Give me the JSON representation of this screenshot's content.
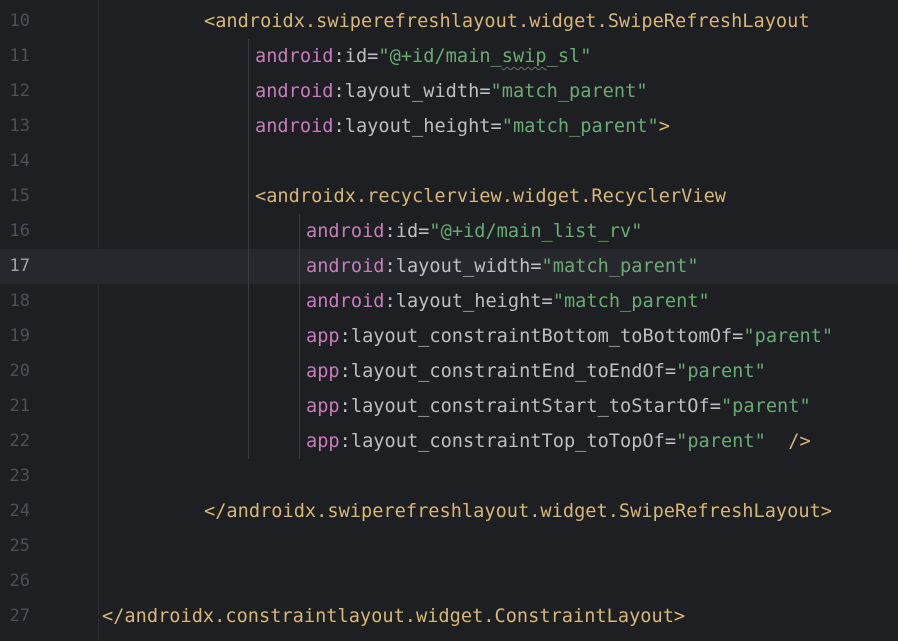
{
  "editor": {
    "current_line": "17",
    "lines": [
      {
        "num": "10",
        "indent": 2,
        "tokens": [
          {
            "t": "tag",
            "v": "<androidx.swiperefreshlayout.widget.SwipeRefreshLayout"
          }
        ]
      },
      {
        "num": "11",
        "indent": 3,
        "tokens": [
          {
            "t": "ns",
            "v": "android"
          },
          {
            "t": "punc",
            "v": ":"
          },
          {
            "t": "attr",
            "v": "id"
          },
          {
            "t": "punc",
            "v": "="
          },
          {
            "t": "str",
            "v": "\"@+id/main_"
          },
          {
            "t": "str",
            "v": "swip",
            "squiggle": true
          },
          {
            "t": "str",
            "v": "_sl\""
          }
        ]
      },
      {
        "num": "12",
        "indent": 3,
        "tokens": [
          {
            "t": "ns",
            "v": "android"
          },
          {
            "t": "punc",
            "v": ":"
          },
          {
            "t": "attr",
            "v": "layout_width"
          },
          {
            "t": "punc",
            "v": "="
          },
          {
            "t": "str",
            "v": "\"match_parent\""
          }
        ]
      },
      {
        "num": "13",
        "indent": 3,
        "tokens": [
          {
            "t": "ns",
            "v": "android"
          },
          {
            "t": "punc",
            "v": ":"
          },
          {
            "t": "attr",
            "v": "layout_height"
          },
          {
            "t": "punc",
            "v": "="
          },
          {
            "t": "str",
            "v": "\"match_parent\""
          },
          {
            "t": "tag",
            "v": ">"
          }
        ]
      },
      {
        "num": "14",
        "indent": 0,
        "tokens": []
      },
      {
        "num": "15",
        "indent": 3,
        "tokens": [
          {
            "t": "tag",
            "v": "<androidx.recyclerview.widget.RecyclerView"
          }
        ]
      },
      {
        "num": "16",
        "indent": 4,
        "tokens": [
          {
            "t": "ns",
            "v": "android"
          },
          {
            "t": "punc",
            "v": ":"
          },
          {
            "t": "attr",
            "v": "id"
          },
          {
            "t": "punc",
            "v": "="
          },
          {
            "t": "str",
            "v": "\"@+id/main_list_rv\""
          }
        ]
      },
      {
        "num": "17",
        "indent": 4,
        "tokens": [
          {
            "t": "ns",
            "v": "android"
          },
          {
            "t": "punc",
            "v": ":"
          },
          {
            "t": "attr",
            "v": "layout_width"
          },
          {
            "t": "punc",
            "v": "="
          },
          {
            "t": "str",
            "v": "\"match_parent\""
          }
        ]
      },
      {
        "num": "18",
        "indent": 4,
        "tokens": [
          {
            "t": "ns",
            "v": "android"
          },
          {
            "t": "punc",
            "v": ":"
          },
          {
            "t": "attr",
            "v": "layout_height"
          },
          {
            "t": "punc",
            "v": "="
          },
          {
            "t": "str",
            "v": "\"match_parent\""
          }
        ]
      },
      {
        "num": "19",
        "indent": 4,
        "tokens": [
          {
            "t": "ns",
            "v": "app"
          },
          {
            "t": "punc",
            "v": ":"
          },
          {
            "t": "attr",
            "v": "layout_constraintBottom_toBottomOf"
          },
          {
            "t": "punc",
            "v": "="
          },
          {
            "t": "str",
            "v": "\"parent\""
          }
        ]
      },
      {
        "num": "20",
        "indent": 4,
        "tokens": [
          {
            "t": "ns",
            "v": "app"
          },
          {
            "t": "punc",
            "v": ":"
          },
          {
            "t": "attr",
            "v": "layout_constraintEnd_toEndOf"
          },
          {
            "t": "punc",
            "v": "="
          },
          {
            "t": "str",
            "v": "\"parent\""
          }
        ]
      },
      {
        "num": "21",
        "indent": 4,
        "tokens": [
          {
            "t": "ns",
            "v": "app"
          },
          {
            "t": "punc",
            "v": ":"
          },
          {
            "t": "attr",
            "v": "layout_constraintStart_toStartOf"
          },
          {
            "t": "punc",
            "v": "="
          },
          {
            "t": "str",
            "v": "\"parent\""
          }
        ]
      },
      {
        "num": "22",
        "indent": 4,
        "tokens": [
          {
            "t": "ns",
            "v": "app"
          },
          {
            "t": "punc",
            "v": ":"
          },
          {
            "t": "attr",
            "v": "layout_constraintTop_toTopOf"
          },
          {
            "t": "punc",
            "v": "="
          },
          {
            "t": "str",
            "v": "\"parent\""
          },
          {
            "t": "tag",
            "v": "  />"
          }
        ]
      },
      {
        "num": "23",
        "indent": 0,
        "tokens": []
      },
      {
        "num": "24",
        "indent": 2,
        "tokens": [
          {
            "t": "tag",
            "v": "</androidx.swiperefreshlayout.widget.SwipeRefreshLayout>"
          }
        ]
      },
      {
        "num": "25",
        "indent": 0,
        "tokens": []
      },
      {
        "num": "26",
        "indent": 0,
        "tokens": []
      },
      {
        "num": "27",
        "indent": 0,
        "tokens": [
          {
            "t": "tag",
            "v": "</androidx.constraintlayout.widget.ConstraintLayout>"
          }
        ]
      }
    ]
  },
  "colors": {
    "background": "#1e1f22",
    "current_line": "#26282e",
    "line_number": "#4b5059",
    "tag": "#d5b778",
    "namespace": "#c77dbb",
    "attribute": "#bcbec4",
    "string": "#6aab73"
  }
}
